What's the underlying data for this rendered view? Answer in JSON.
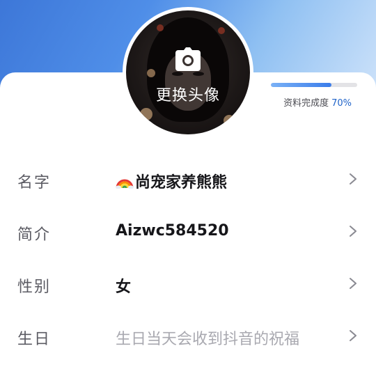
{
  "avatar": {
    "change_label": "更换头像"
  },
  "profile_completion": {
    "label": "资料完成度",
    "percent_text": "70%",
    "fraction": 0.7
  },
  "fields": [
    {
      "label": "名字",
      "value": "尚宠家养熊熊",
      "emoji": "rainbow",
      "placeholder": false
    },
    {
      "label": "简介",
      "value": "Aizwc584520",
      "placeholder": false
    },
    {
      "label": "性别",
      "value": "女",
      "placeholder": false
    },
    {
      "label": "生日",
      "value": "生日当天会收到抖音的祝福",
      "placeholder": true
    }
  ],
  "colors": {
    "accent": "#1f63c9",
    "label_text": "#5b5b63",
    "value_text": "#16161a",
    "placeholder_text": "#a9a9b0"
  },
  "icons": {
    "camera": "camera-icon",
    "chevron": "chevron-right-icon"
  }
}
